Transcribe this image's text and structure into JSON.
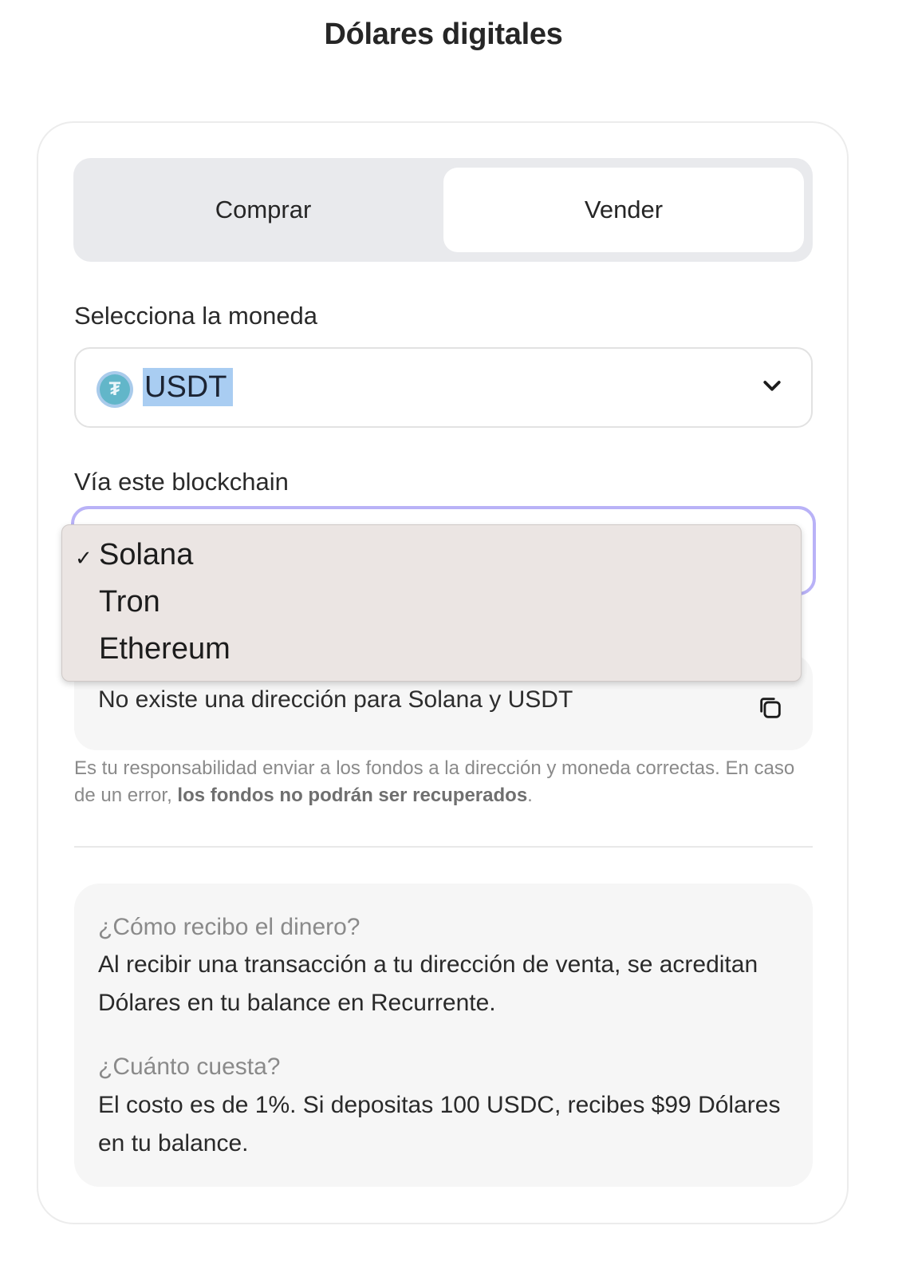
{
  "page": {
    "title": "Dólares digitales"
  },
  "tabs": {
    "buy_label": "Comprar",
    "sell_label": "Vender",
    "active": "Vender"
  },
  "currency": {
    "label": "Selecciona la moneda",
    "selected": "USDT",
    "icon": "tether-icon"
  },
  "blockchain": {
    "label": "Vía este blockchain",
    "options": [
      "Solana",
      "Tron",
      "Ethereum"
    ],
    "selected": "Solana",
    "check": "✓"
  },
  "address": {
    "text": "No existe una dirección para Solana y USDT",
    "icon": "copy-icon"
  },
  "warning": {
    "text": "Es tu responsabilidad enviar a los fondos a la dirección y moneda correctas. En caso de un error, ",
    "bold": "los fondos no podrán ser recuperados",
    "end": "."
  },
  "faq": {
    "q1": "¿Cómo recibo el dinero?",
    "a1": "Al recibir una transacción a tu dirección de venta, se acreditan Dólares en tu balance en Recurrente.",
    "q2": "¿Cuánto cuesta?",
    "a2": "El costo es de 1%. Si depositas 100 USDC, recibes $99 Dólares en tu balance."
  },
  "colors": {
    "accent_focus": "#b9b2f7",
    "tether": "#62b6c9",
    "selection_highlight": "#a9cdf2"
  }
}
